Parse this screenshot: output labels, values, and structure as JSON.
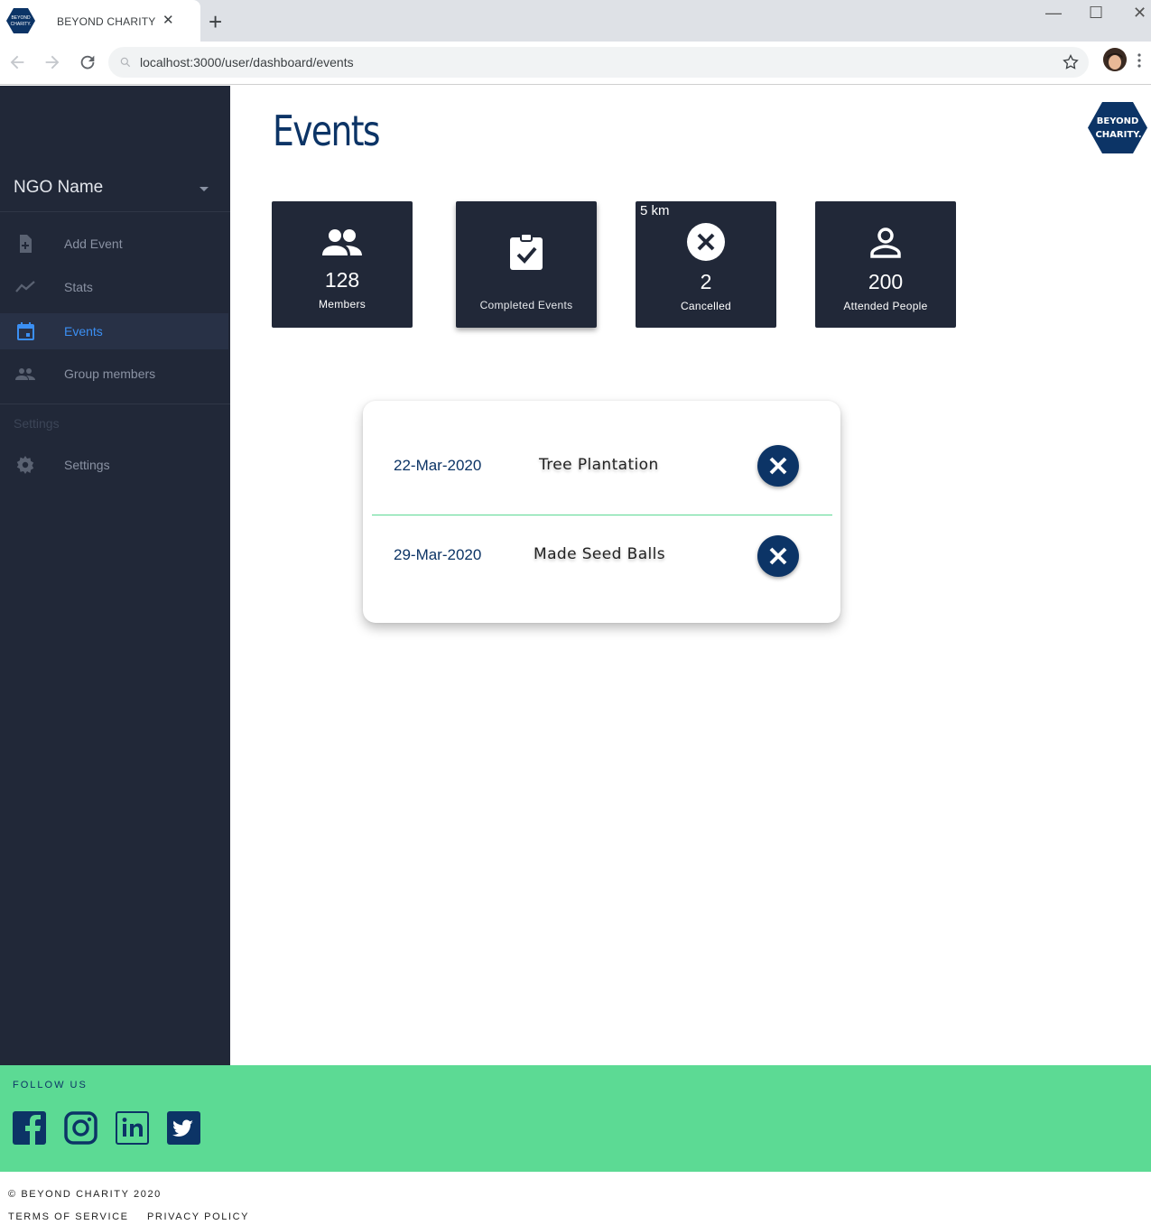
{
  "browser": {
    "tab_title": "BEYOND CHARITY",
    "tab_close": "✕",
    "new_tab": "+",
    "url": "localhost:3000/user/dashboard/events",
    "minimize": "—",
    "maximize": "☐",
    "close": "✕"
  },
  "brand": {
    "line1": "BEYOND",
    "line2": "CHARITY.",
    "color": "#0c3466"
  },
  "sidebar": {
    "org_name": "NGO Name",
    "items": [
      {
        "label": "Add Event",
        "icon": "add-document-icon"
      },
      {
        "label": "Stats",
        "icon": "trend-line-icon"
      },
      {
        "label": "Events",
        "icon": "calendar-icon",
        "active": true
      },
      {
        "label": "Group members",
        "icon": "people-icon"
      }
    ],
    "settings_heading": "Settings",
    "settings_item": {
      "label": "Settings",
      "icon": "gear-icon"
    },
    "active_color": "#3b8ff3"
  },
  "page": {
    "title": "Events"
  },
  "stats": [
    {
      "value": "128",
      "label": "Members",
      "icon": "people-icon"
    },
    {
      "value": "",
      "label": "Completed Events",
      "icon": "clipboard-check-icon"
    },
    {
      "tag": "5 km",
      "value": "2",
      "label": "Cancelled",
      "icon": "cancel-circle-icon"
    },
    {
      "value": "200",
      "label": "Attended People",
      "icon": "person-icon"
    }
  ],
  "events": [
    {
      "date": "22-Mar-2020",
      "name": "Tree Plantation"
    },
    {
      "date": "29-Mar-2020",
      "name": "Made Seed Balls"
    }
  ],
  "footer": {
    "follow_label": "FOLLOW US",
    "social": [
      "facebook-icon",
      "instagram-icon",
      "linkedin-icon",
      "twitter-icon"
    ],
    "copyright": "© BEYOND CHARITY 2020",
    "terms": "TERMS OF SERVICE",
    "privacy": "PRIVACY POLICY",
    "accent": "#5cda94"
  }
}
